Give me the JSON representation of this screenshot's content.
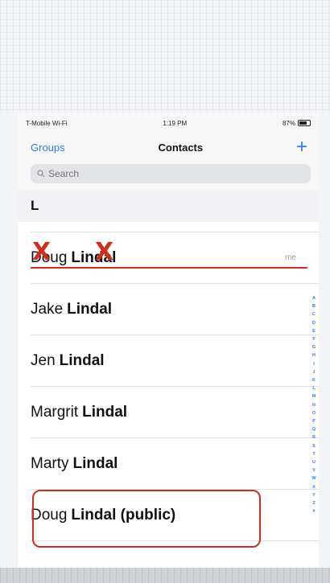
{
  "status": {
    "carrier": "T-Mobile Wi-Fi",
    "time": "1:19 PM",
    "battery": "87%"
  },
  "nav": {
    "back_label": "Groups",
    "title": "Contacts",
    "add_label": "+"
  },
  "search": {
    "placeholder": "Search"
  },
  "section_letter": "L",
  "contacts": [
    {
      "first": "Doug",
      "last": "Lindal",
      "badge": "me"
    },
    {
      "first": "Jake",
      "last": "Lindal"
    },
    {
      "first": "Jen",
      "last": "Lindal"
    },
    {
      "first": "Margrit",
      "last": "Lindal"
    },
    {
      "first": "Marty",
      "last": "Lindal"
    },
    {
      "first": "Doug",
      "last": "Lindal (public)"
    }
  ],
  "annotations": {
    "cross_mark": "X",
    "color": "#cf2e1c"
  },
  "index_letters": [
    "A",
    "B",
    "C",
    "D",
    "E",
    "F",
    "G",
    "H",
    "I",
    "J",
    "K",
    "L",
    "M",
    "N",
    "O",
    "P",
    "Q",
    "R",
    "S",
    "T",
    "U",
    "V",
    "W",
    "X",
    "Y",
    "Z",
    "#"
  ],
  "colors": {
    "accent": "#3478f6",
    "annotation": "#cf2e1c"
  }
}
